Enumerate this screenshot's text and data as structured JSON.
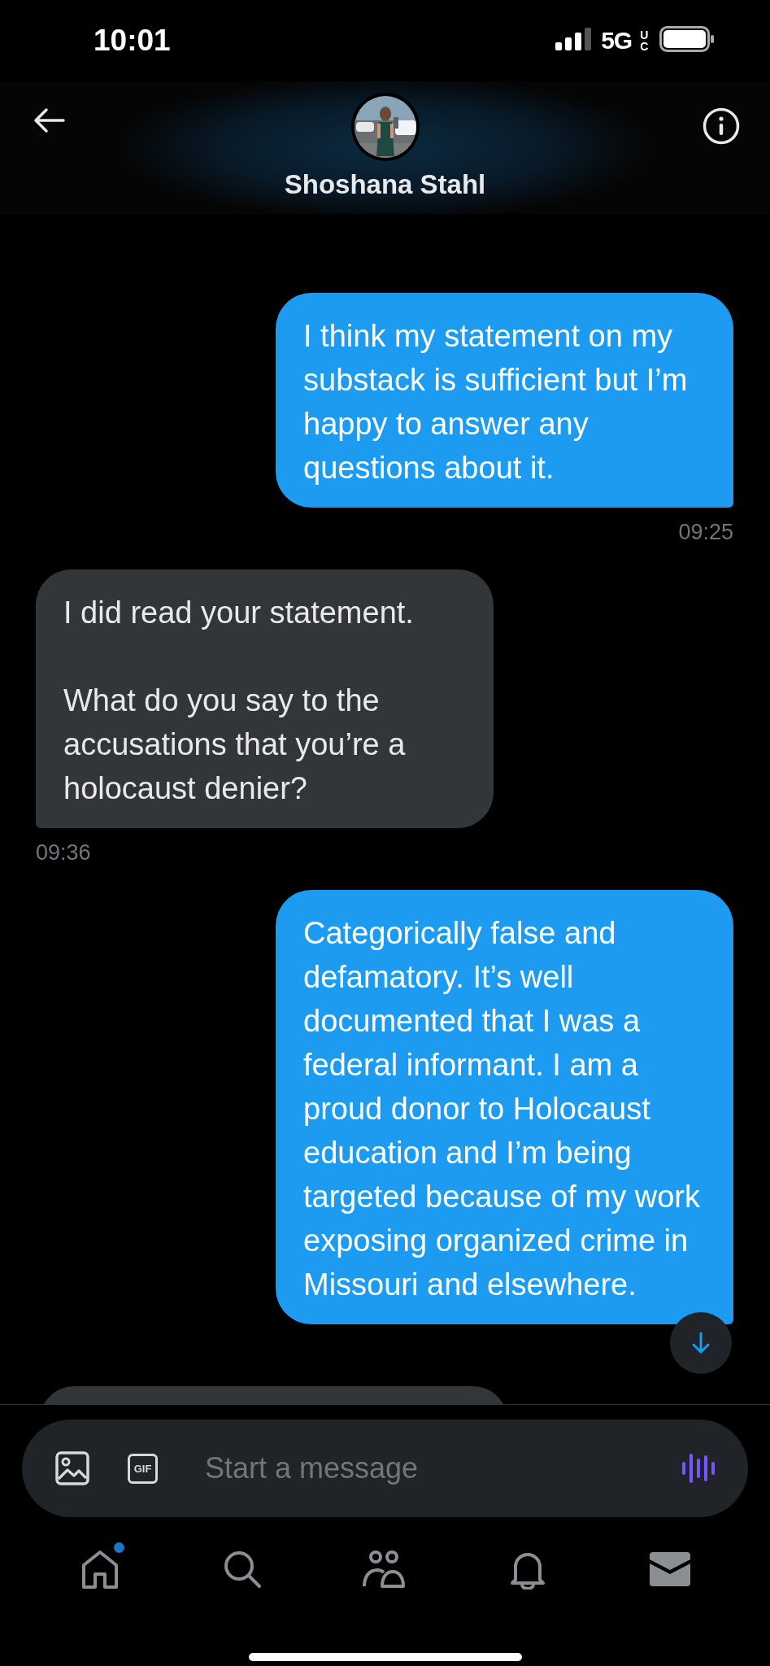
{
  "status_bar": {
    "time": "10:01",
    "network": "5G",
    "network_suffix": "UC"
  },
  "header": {
    "contact_name": "Shoshana Stahl"
  },
  "messages": [
    {
      "kind": "sent",
      "text": "I think my statement on my substack is sufficient but I’m happy to answer any questions about it.",
      "time": "09:25"
    },
    {
      "kind": "received",
      "text": "I did read your statement.\n\nWhat do you say to the accusations that you’re a holocaust denier?",
      "time": "09:36"
    },
    {
      "kind": "sent",
      "text": "Categorically false and defamatory. It’s well documented that I was a federal informant. I am a proud donor to Holocaust education and I’m being targeted because of my work exposing organized crime in Missouri and elsewhere."
    }
  ],
  "next_message_peek": {
    "kind": "received"
  },
  "composer": {
    "placeholder": "Start a message",
    "gif_label": "GIF"
  },
  "tabs": [
    {
      "selected": false,
      "badge": true
    },
    {
      "selected": false,
      "badge": false
    },
    {
      "selected": false,
      "badge": false
    },
    {
      "selected": false,
      "badge": false
    },
    {
      "selected": true,
      "badge": false
    }
  ]
}
